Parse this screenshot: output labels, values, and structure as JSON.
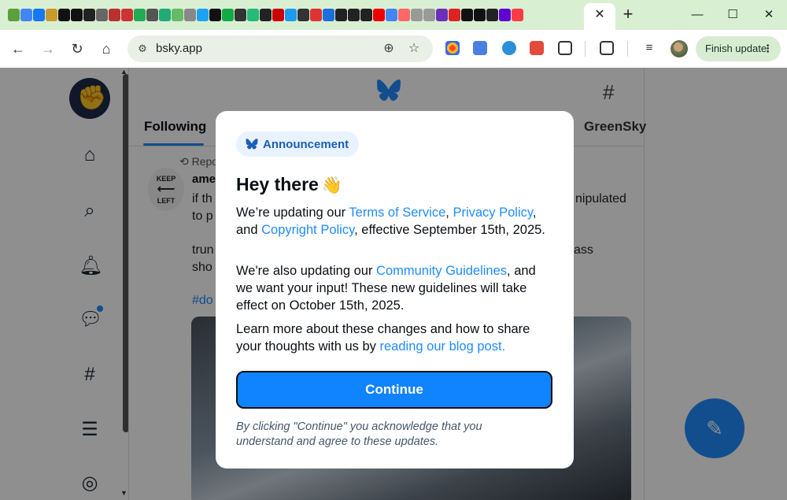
{
  "browser": {
    "url": "bsky.app",
    "update_label": "Finish update",
    "tab_favicon_colors": [
      "#5aa03c",
      "#4285f4",
      "#1877f2",
      "#c99a2e",
      "#111",
      "#111",
      "#222",
      "#666",
      "#b8312f",
      "#c33",
      "#2a5",
      "#555",
      "#2a7",
      "#6b6",
      "#888",
      "#1da1f2",
      "#111",
      "#1a4",
      "#333",
      "#2b7",
      "#222",
      "#c00",
      "#1d9bf0",
      "#333",
      "#d33",
      "#1e6fd9",
      "#222",
      "#222",
      "#222",
      "#e00",
      "#4285f4",
      "#f66",
      "#999",
      "#999",
      "#6b2fb8",
      "#d22",
      "#111",
      "#111",
      "#222",
      "#6001d2",
      "#fc3c44"
    ]
  },
  "page": {
    "tabs": {
      "following": "Following",
      "greensky": "GreenSky"
    },
    "post": {
      "repost_label": "Repo",
      "author": "ame",
      "lines": [
        "if th",
        "to p",
        "trun",
        "sho"
      ],
      "right_fragments": [
        "nipulated",
        "ass"
      ],
      "tag": "#do",
      "avatar_text_top": "KEEP",
      "avatar_text_bottom": "LEFT"
    }
  },
  "modal": {
    "badge": "Announcement",
    "title": "Hey there",
    "title_emoji": "👋",
    "para1": {
      "t1": "We’re updating our ",
      "l1": "Terms of Service",
      "t2": ", ",
      "l2": "Privacy Policy",
      "t3": ", and ",
      "l3": "Copyright Policy",
      "t4": ", effective September 15th, 2025."
    },
    "para2": {
      "t1": "We're also updating our ",
      "l1": "Community Guidelines",
      "t2": ", and we want your input! These new guidelines will take effect on October 15th, 2025."
    },
    "para3": {
      "t1": "Learn more about these changes and how to share your thoughts with us by ",
      "l1": "reading our blog post."
    },
    "continue": "Continue",
    "fineprint": "By clicking \"Continue\" you acknowledge that you understand and agree to these updates."
  },
  "colors": {
    "accent": "#208bfe",
    "button": "#1083fe",
    "link": "#208bfe",
    "tabbar": "#d9efd2"
  }
}
